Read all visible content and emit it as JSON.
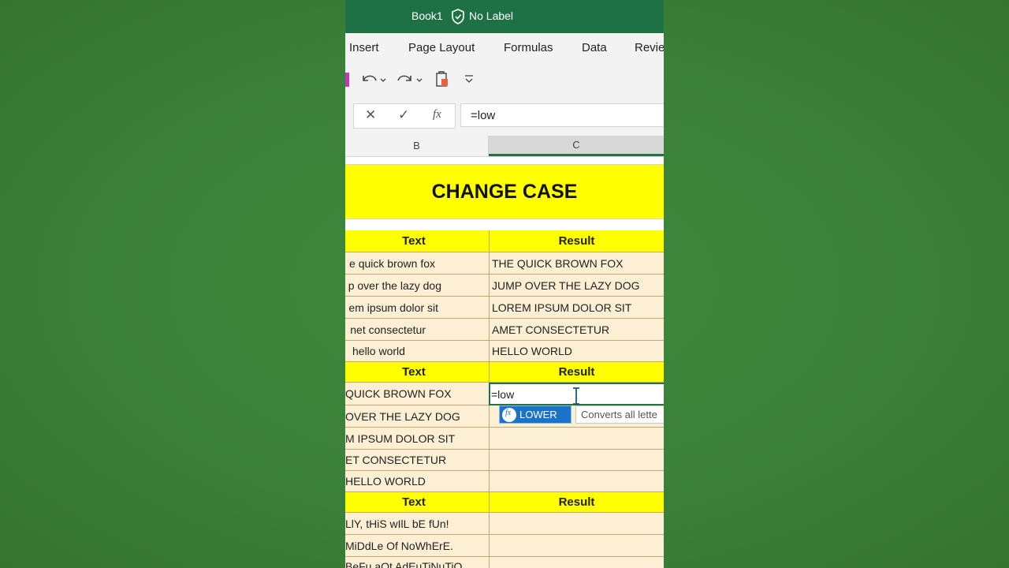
{
  "window": {
    "title": "Book1",
    "label": "No Label"
  },
  "ribbon": {
    "tabs": [
      "Insert",
      "Page Layout",
      "Formulas",
      "Data",
      "Revie"
    ]
  },
  "formula_bar": {
    "cancel": "✕",
    "enter": "✓",
    "fx": "fx",
    "value": "=low"
  },
  "columns": {
    "b": "B",
    "c": "C"
  },
  "sheet": {
    "title": "CHANGE CASE",
    "header": {
      "text": "Text",
      "result": "Result"
    },
    "block1": [
      {
        "text": "e quick brown fox",
        "result": "THE QUICK BROWN FOX"
      },
      {
        "text": "p over the lazy dog",
        "result": "JUMP OVER THE LAZY DOG"
      },
      {
        "text": "em ipsum dolor sit",
        "result": "LOREM IPSUM DOLOR SIT"
      },
      {
        "text": "net consectetur",
        "result": "AMET CONSECTETUR"
      },
      {
        "text": "hello world",
        "result": "HELLO WORLD"
      }
    ],
    "block2": [
      {
        "text": "QUICK BROWN FOX",
        "result": "=low"
      },
      {
        "text": "OVER THE LAZY DOG",
        "result": ""
      },
      {
        "text": "M IPSUM DOLOR SIT",
        "result": ""
      },
      {
        "text": "ET CONSECTETUR",
        "result": ""
      },
      {
        "text": "HELLO WORLD",
        "result": ""
      }
    ],
    "block3": [
      {
        "text": "LlY, tHiS wIlL bE fUn!",
        "result": ""
      },
      {
        "text": "MiDdLe Of NoWhErE.",
        "result": ""
      },
      {
        "text": "BeFu aOt AdEuTiNuTiO",
        "result": ""
      }
    ]
  },
  "autocomplete": {
    "item": "LOWER",
    "tooltip": "Converts all lette"
  },
  "colors": {
    "accent": "#217346",
    "title_bar": "#1e7145",
    "highlight": "#ffff00",
    "data_fill": "#fdefd4",
    "background": "#3b7f39"
  }
}
